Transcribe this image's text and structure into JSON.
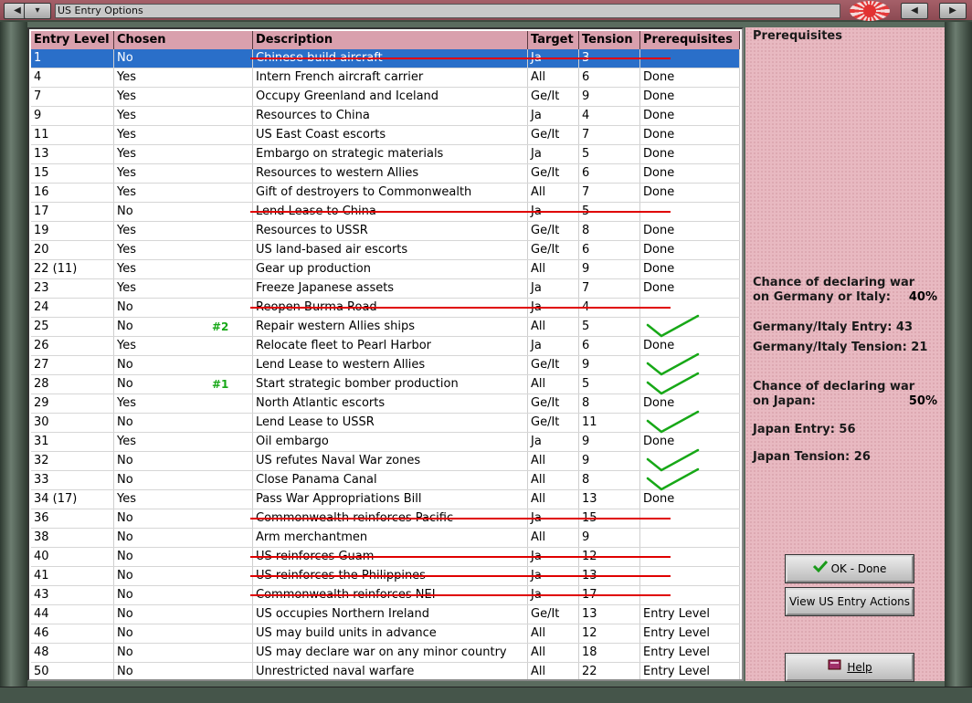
{
  "window": {
    "title": "US Entry Options"
  },
  "columns": [
    "Entry Level",
    "Chosen",
    "Description",
    "Target",
    "Tension",
    "Prerequisites"
  ],
  "rows": [
    {
      "level": "1",
      "chosen": "No",
      "desc": "Chinese build aircraft",
      "target": "Ja",
      "tension": "3",
      "prereq": "",
      "struck": true,
      "selected": true
    },
    {
      "level": "4",
      "chosen": "Yes",
      "desc": "Intern French aircraft carrier",
      "target": "All",
      "tension": "6",
      "prereq": "Done"
    },
    {
      "level": "7",
      "chosen": "Yes",
      "desc": "Occupy Greenland and Iceland",
      "target": "Ge/It",
      "tension": "9",
      "prereq": "Done"
    },
    {
      "level": "9",
      "chosen": "Yes",
      "desc": "Resources to China",
      "target": "Ja",
      "tension": "4",
      "prereq": "Done"
    },
    {
      "level": "11",
      "chosen": "Yes",
      "desc": "US East Coast escorts",
      "target": "Ge/It",
      "tension": "7",
      "prereq": "Done"
    },
    {
      "level": "13",
      "chosen": "Yes",
      "desc": "Embargo on strategic materials",
      "target": "Ja",
      "tension": "5",
      "prereq": "Done"
    },
    {
      "level": "15",
      "chosen": "Yes",
      "desc": "Resources to western Allies",
      "target": "Ge/It",
      "tension": "6",
      "prereq": "Done"
    },
    {
      "level": "16",
      "chosen": "Yes",
      "desc": "Gift of destroyers to Commonwealth",
      "target": "All",
      "tension": "7",
      "prereq": "Done"
    },
    {
      "level": "17",
      "chosen": "No",
      "desc": "Lend Lease to China",
      "target": "Ja",
      "tension": "5",
      "prereq": "",
      "struck": true
    },
    {
      "level": "19",
      "chosen": "Yes",
      "desc": "Resources to USSR",
      "target": "Ge/It",
      "tension": "8",
      "prereq": "Done"
    },
    {
      "level": "20",
      "chosen": "Yes",
      "desc": "US land-based air escorts",
      "target": "Ge/It",
      "tension": "6",
      "prereq": "Done"
    },
    {
      "level": "22 (11)",
      "chosen": "Yes",
      "desc": "Gear up production",
      "target": "All",
      "tension": "9",
      "prereq": "Done"
    },
    {
      "level": "23",
      "chosen": "Yes",
      "desc": "Freeze Japanese assets",
      "target": "Ja",
      "tension": "7",
      "prereq": "Done"
    },
    {
      "level": "24",
      "chosen": "No",
      "desc": "Reopen Burma Road",
      "target": "Ja",
      "tension": "4",
      "prereq": "",
      "struck": true
    },
    {
      "level": "25",
      "chosen": "No",
      "desc": "Repair western Allies ships",
      "target": "All",
      "tension": "5",
      "prereq": "",
      "marker": "#2",
      "check": true
    },
    {
      "level": "26",
      "chosen": "Yes",
      "desc": "Relocate fleet to Pearl Harbor",
      "target": "Ja",
      "tension": "6",
      "prereq": "Done"
    },
    {
      "level": "27",
      "chosen": "No",
      "desc": "Lend Lease to western Allies",
      "target": "Ge/It",
      "tension": "9",
      "prereq": "",
      "check": true
    },
    {
      "level": "28",
      "chosen": "No",
      "desc": "Start strategic bomber production",
      "target": "All",
      "tension": "5",
      "prereq": "",
      "marker": "#1",
      "check": true
    },
    {
      "level": "29",
      "chosen": "Yes",
      "desc": "North Atlantic escorts",
      "target": "Ge/It",
      "tension": "8",
      "prereq": "Done"
    },
    {
      "level": "30",
      "chosen": "No",
      "desc": "Lend Lease to USSR",
      "target": "Ge/It",
      "tension": "11",
      "prereq": "",
      "check": true
    },
    {
      "level": "31",
      "chosen": "Yes",
      "desc": "Oil embargo",
      "target": "Ja",
      "tension": "9",
      "prereq": "Done"
    },
    {
      "level": "32",
      "chosen": "No",
      "desc": "US refutes Naval War zones",
      "target": "All",
      "tension": "9",
      "prereq": "",
      "check": true
    },
    {
      "level": "33",
      "chosen": "No",
      "desc": "Close Panama Canal",
      "target": "All",
      "tension": "8",
      "prereq": "",
      "check": true
    },
    {
      "level": "34 (17)",
      "chosen": "Yes",
      "desc": "Pass War Appropriations Bill",
      "target": "All",
      "tension": "13",
      "prereq": "Done"
    },
    {
      "level": "36",
      "chosen": "No",
      "desc": "Commonwealth reinforces Pacific",
      "target": "Ja",
      "tension": "15",
      "prereq": "",
      "struck": true
    },
    {
      "level": "38",
      "chosen": "No",
      "desc": "Arm merchantmen",
      "target": "All",
      "tension": "9",
      "prereq": ""
    },
    {
      "level": "40",
      "chosen": "No",
      "desc": "US reinforces Guam",
      "target": "Ja",
      "tension": "12",
      "prereq": "",
      "struck": true
    },
    {
      "level": "41",
      "chosen": "No",
      "desc": "US reinforces the Philippines",
      "target": "Ja",
      "tension": "13",
      "prereq": "",
      "struck": true
    },
    {
      "level": "43",
      "chosen": "No",
      "desc": "Commonwealth reinforces NEI",
      "target": "Ja",
      "tension": "17",
      "prereq": "",
      "struck": true
    },
    {
      "level": "44",
      "chosen": "No",
      "desc": "US occupies Northern Ireland",
      "target": "Ge/It",
      "tension": "13",
      "prereq": "Entry Level"
    },
    {
      "level": "46",
      "chosen": "No",
      "desc": "US may build units in advance",
      "target": "All",
      "tension": "12",
      "prereq": "Entry Level"
    },
    {
      "level": "48",
      "chosen": "No",
      "desc": "US may declare war on any minor country",
      "target": "All",
      "tension": "18",
      "prereq": "Entry Level"
    },
    {
      "level": "50",
      "chosen": "No",
      "desc": "Unrestricted naval warfare",
      "target": "All",
      "tension": "22",
      "prereq": "Entry Level"
    }
  ],
  "panel": {
    "heading": "Prerequisites",
    "ge_chance_line1": "Chance of declaring war",
    "ge_chance_line2": "on Germany or Italy:",
    "ge_chance_pct": "40%",
    "ge_entry": "Germany/Italy Entry: 43",
    "ge_tension": "Germany/Italy Tension: 21",
    "ja_chance_line1": "Chance of declaring war",
    "ja_chance_line2": "on Japan:",
    "ja_chance_pct": "50%",
    "ja_entry": "Japan Entry: 56",
    "ja_tension": "Japan Tension: 26"
  },
  "buttons": {
    "ok": "OK - Done",
    "view": "View US Entry Actions",
    "help": "Help"
  },
  "colors": {
    "strike": "#e00000",
    "check": "#17a817",
    "selected": "#2a6fc9"
  },
  "icons": {
    "ok": "checkmark-icon",
    "help": "book-icon"
  }
}
